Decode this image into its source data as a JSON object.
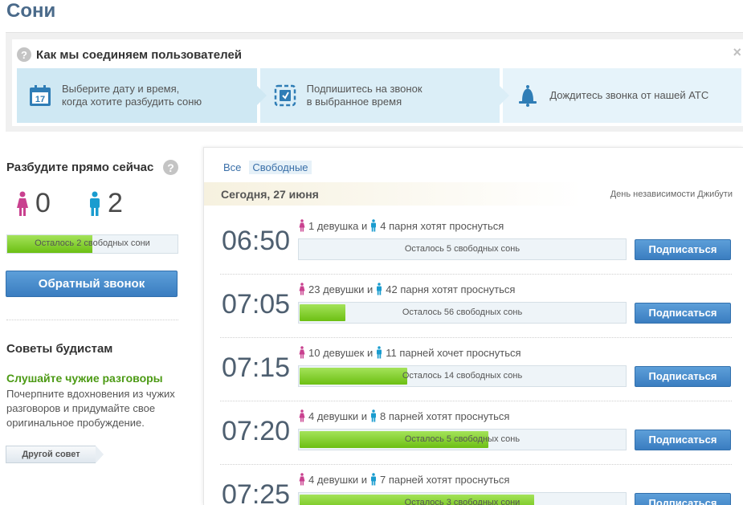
{
  "page_title": "Сони",
  "howto": {
    "title": "Как мы соединяем пользователей",
    "close": "×",
    "steps": [
      {
        "line1": "Выберите дату и время,",
        "line2": "когда хотите разбудить соню",
        "icon": "calendar-icon",
        "icon_text": "17"
      },
      {
        "line1": "Подпишитесь на звонок",
        "line2": "в выбранное время",
        "icon": "subscribe-icon"
      },
      {
        "line1": "Дождитесь звонка от нашей АТС",
        "line2": "",
        "icon": "bell-icon"
      }
    ]
  },
  "wake_now": {
    "title": "Разбудите прямо сейчас",
    "help": "?",
    "girls_count": "0",
    "boys_count": "2",
    "bar_text": "Осталось 2 свободных сони",
    "bar_fraction": 0.5,
    "button": "Обратный звонок"
  },
  "tips": {
    "title": "Советы будистам",
    "tip_title": "Слушайте чужие разговоры",
    "tip_text": "Почерпните вдохновения из чужих разговоров и придумайте свое оригинальное пробуждение.",
    "other_button": "Другой совет"
  },
  "filters": [
    {
      "label": "Все",
      "active": false
    },
    {
      "label": "Свободные",
      "active": true
    }
  ],
  "date_strip": {
    "date": "Сегодня, 27 июня",
    "holiday": "День независимости Джибути"
  },
  "slots": [
    {
      "time": "06:50",
      "girls": "1 девушка и",
      "boys": "4 парня хотят проснуться",
      "bar_text": "Осталось 5 свободных сонь",
      "fill_fraction": 0.0,
      "button": "Подписаться"
    },
    {
      "time": "07:05",
      "girls": "23 девушки и",
      "boys": "42 парня хотят проснуться",
      "bar_text": "Осталось 56 свободных сонь",
      "fill_fraction": 0.14,
      "button": "Подписаться"
    },
    {
      "time": "07:15",
      "girls": "10 девушек и",
      "boys": "11 парней хочет проснуться",
      "bar_text": "Осталось 14 свободных сонь",
      "fill_fraction": 0.33,
      "button": "Подписаться"
    },
    {
      "time": "07:20",
      "girls": "4 девушки и",
      "boys": "8 парней хотят проснуться",
      "bar_text": "Осталось 5 свободных сонь",
      "fill_fraction": 0.58,
      "button": "Подписаться"
    },
    {
      "time": "07:25",
      "girls": "4 девушки и",
      "boys": "7 парней хотят проснуться",
      "bar_text": "Осталось 3 свободных сони",
      "fill_fraction": 0.72,
      "button": "Подписаться"
    }
  ],
  "colors": {
    "accent_blue": "#3a7dc0",
    "progress_green": "#6cbf13",
    "girl_pink": "#c9418f",
    "boy_blue": "#1a9ccf"
  }
}
